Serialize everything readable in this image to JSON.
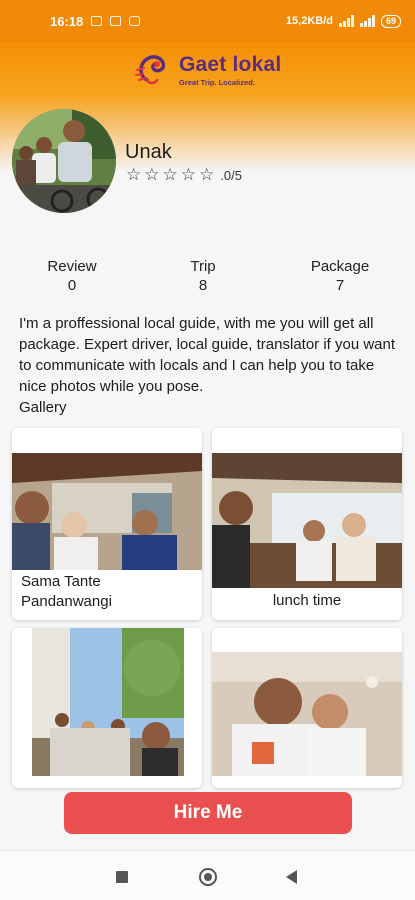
{
  "status_bar": {
    "time": "16:18",
    "network_speed": "15,2KB/d",
    "battery": "69"
  },
  "header": {
    "logo_title": "Gaet lokal",
    "logo_tagline": "Great Trip. Localized."
  },
  "profile": {
    "name": "Unak",
    "rating_text": ".0/5",
    "rating_value": 0,
    "rating_max": 5
  },
  "stats": [
    {
      "label": "Review",
      "value": "0"
    },
    {
      "label": "Trip",
      "value": "8"
    },
    {
      "label": "Package",
      "value": "7"
    }
  ],
  "bio": "I'm a proffessional local guide, with me you will get all package. Expert driver, local guide, translator if you want to communicate with locals and I can help you to take nice photos while you pose.",
  "gallery": {
    "title": "Gallery",
    "items": [
      {
        "caption": "Sama Tante Pandanwangi"
      },
      {
        "caption": "lunch time"
      },
      {
        "caption": ""
      },
      {
        "caption": ""
      }
    ]
  },
  "actions": {
    "hire_label": "Hire Me"
  },
  "colors": {
    "brand_orange": "#f08a08",
    "brand_purple": "#5b2d7e",
    "hire_button": "#ea4f4f"
  }
}
